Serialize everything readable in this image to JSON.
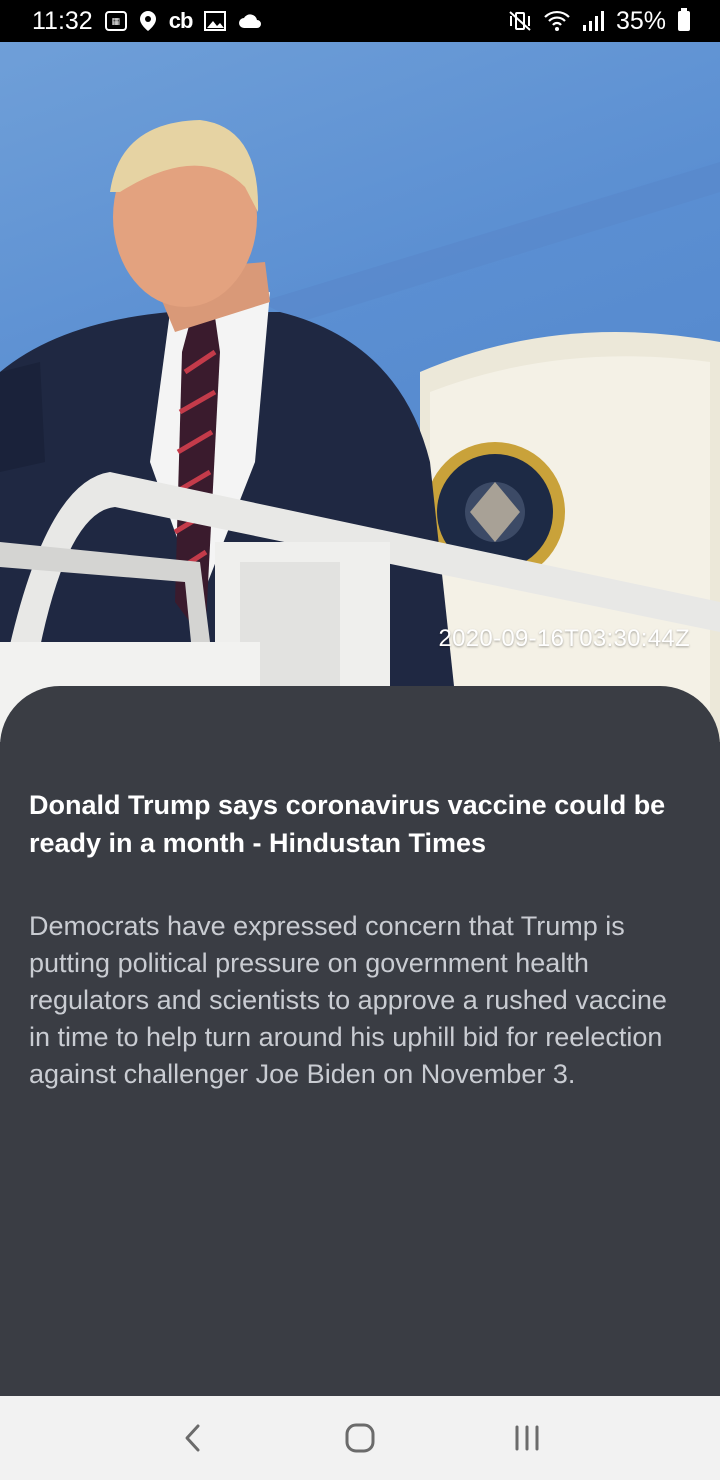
{
  "status_bar": {
    "time": "11:32",
    "battery_percent": "35%",
    "left_icons": [
      "calendar-icon",
      "location-icon",
      "cb-app-icon",
      "image-icon",
      "cloud-icon"
    ],
    "right_icons": [
      "mute-vibrate-icon",
      "wifi-icon",
      "signal-icon",
      "battery-icon"
    ]
  },
  "article": {
    "image_alt_icon": "article-photo",
    "timestamp": "2020-09-16T03:30:44Z",
    "headline": "Donald Trump says coronavirus vaccine could be ready in a month - Hindustan Times",
    "description": "Democrats have expressed concern that Trump is putting political pressure on government health regulators and scientists to approve a rushed vaccine in time to help turn around his uphill bid for reelection against challenger Joe Biden on November 3."
  },
  "nav_bar": {
    "buttons": [
      "back-icon",
      "home-icon",
      "recents-icon"
    ]
  },
  "colors": {
    "card_background": "#3a3d44",
    "headline": "#ffffff",
    "description": "#c9ccd2",
    "status_bar": "#000000",
    "nav_bar": "#f2f2f2"
  }
}
